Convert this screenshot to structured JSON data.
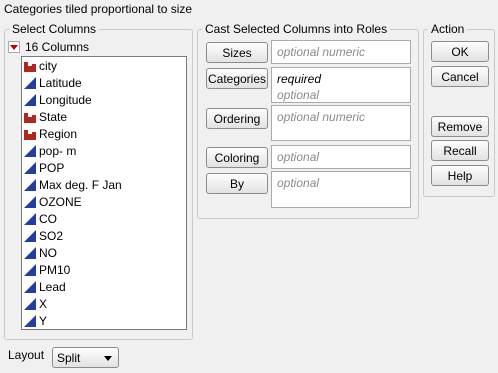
{
  "window": {
    "title": "Categories tiled proportional to size"
  },
  "select_columns": {
    "legend": "Select Columns",
    "count_label": "16 Columns",
    "columns": [
      {
        "name": "city",
        "type": "nominal"
      },
      {
        "name": "Latitude",
        "type": "continuous"
      },
      {
        "name": "Longitude",
        "type": "continuous"
      },
      {
        "name": "State",
        "type": "nominal"
      },
      {
        "name": "Region",
        "type": "nominal"
      },
      {
        "name": "pop- m",
        "type": "continuous"
      },
      {
        "name": "POP",
        "type": "continuous"
      },
      {
        "name": "Max deg. F Jan",
        "type": "continuous"
      },
      {
        "name": "OZONE",
        "type": "continuous"
      },
      {
        "name": "CO",
        "type": "continuous"
      },
      {
        "name": "SO2",
        "type": "continuous"
      },
      {
        "name": "NO",
        "type": "continuous"
      },
      {
        "name": "PM10",
        "type": "continuous"
      },
      {
        "name": "Lead",
        "type": "continuous"
      },
      {
        "name": "X",
        "type": "continuous"
      },
      {
        "name": "Y",
        "type": "continuous"
      }
    ]
  },
  "cast_roles": {
    "legend": "Cast Selected Columns into Roles",
    "roles": [
      {
        "button": "Sizes",
        "hint": "optional numeric"
      },
      {
        "button": "Categories",
        "required": "required",
        "hint": "optional"
      },
      {
        "button": "Ordering",
        "hint": "optional numeric"
      },
      {
        "button": "Coloring",
        "hint": "optional"
      },
      {
        "button": "By",
        "hint": "optional"
      }
    ]
  },
  "action": {
    "legend": "Action",
    "ok": "OK",
    "cancel": "Cancel",
    "remove": "Remove",
    "recall": "Recall",
    "help": "Help"
  },
  "layout": {
    "label": "Layout",
    "value": "Split"
  },
  "colors": {
    "nominal_icon": "#b3261e",
    "continuous_icon": "#1f3fa3"
  }
}
